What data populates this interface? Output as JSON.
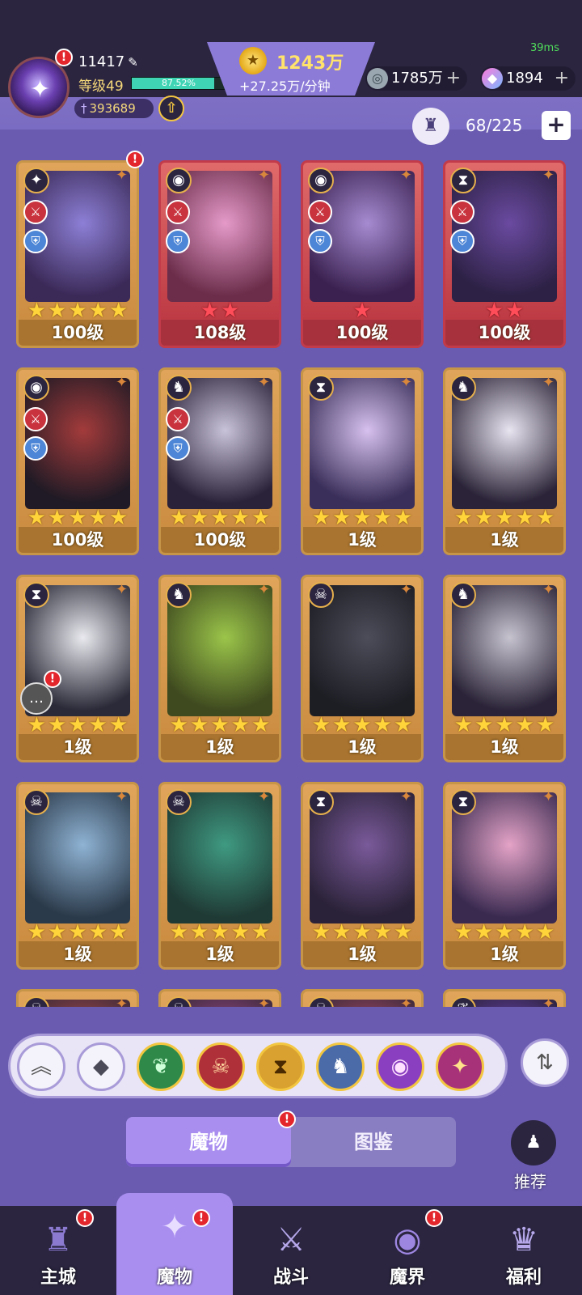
{
  "status": {
    "latency": "39ms"
  },
  "player": {
    "uid": "11417",
    "level_label": "等级49",
    "xp_percent": 87.52,
    "xp_text": "87.52%",
    "power": "393689"
  },
  "currency": {
    "gold": "1243万",
    "gold_rate": "+27.25万/分钟",
    "silver": "1785万",
    "gems": "1894"
  },
  "roster": {
    "capacity": "68/225"
  },
  "cards": [
    {
      "level": "100级",
      "stars": 5,
      "star_color": "gold",
      "faction": "✦",
      "style": "gold",
      "art": [
        "#3b2a58",
        "#8d7fd6"
      ],
      "buffs": true,
      "alert": true
    },
    {
      "level": "108级",
      "stars": 2,
      "star_color": "red",
      "faction": "◉",
      "style": "red",
      "art": [
        "#6b2d4a",
        "#e59ac9"
      ],
      "buffs": true,
      "alert": false
    },
    {
      "level": "100级",
      "stars": 1,
      "star_color": "red",
      "faction": "◉",
      "style": "red",
      "art": [
        "#3a2150",
        "#a68bd1"
      ],
      "buffs": true,
      "alert": false
    },
    {
      "level": "100级",
      "stars": 2,
      "star_color": "red",
      "faction": "⧗",
      "style": "red",
      "art": [
        "#2d2145",
        "#6a4aa0"
      ],
      "buffs": true,
      "alert": false
    },
    {
      "level": "100级",
      "stars": 5,
      "star_color": "gold",
      "faction": "◉",
      "style": "gold",
      "art": [
        "#1f1a25",
        "#a33b3b"
      ],
      "buffs": true,
      "alert": false
    },
    {
      "level": "100级",
      "stars": 5,
      "star_color": "gold",
      "faction": "♞",
      "style": "gold",
      "art": [
        "#2a2238",
        "#c9c3d9"
      ],
      "buffs": true,
      "alert": false
    },
    {
      "level": "1级",
      "stars": 5,
      "star_color": "gold",
      "faction": "⧗",
      "style": "gold",
      "art": [
        "#3a2f5a",
        "#d7c1ee"
      ],
      "buffs": false,
      "alert": false
    },
    {
      "level": "1级",
      "stars": 5,
      "star_color": "gold",
      "faction": "♞",
      "style": "gold",
      "art": [
        "#2b2438",
        "#e8e4f0"
      ],
      "buffs": false,
      "alert": false
    },
    {
      "level": "1级",
      "stars": 5,
      "star_color": "gold",
      "faction": "⧗",
      "style": "gold",
      "art": [
        "#2a2a38",
        "#e9e9ef"
      ],
      "buffs": false,
      "alert": false,
      "chat": true
    },
    {
      "level": "1级",
      "stars": 5,
      "star_color": "gold",
      "faction": "♞",
      "style": "gold",
      "art": [
        "#3f4a1f",
        "#9bc54a"
      ],
      "buffs": false,
      "alert": false
    },
    {
      "level": "1级",
      "stars": 5,
      "star_color": "gold",
      "faction": "☠",
      "style": "gold",
      "art": [
        "#1d1d24",
        "#4d4d5a"
      ],
      "buffs": false,
      "alert": false
    },
    {
      "level": "1级",
      "stars": 5,
      "star_color": "gold",
      "faction": "♞",
      "style": "gold",
      "art": [
        "#2b2438",
        "#c6c3cf"
      ],
      "buffs": false,
      "alert": false
    },
    {
      "level": "1级",
      "stars": 5,
      "star_color": "gold",
      "faction": "☠",
      "style": "gold",
      "art": [
        "#2b3a4a",
        "#8fb3d4"
      ],
      "buffs": false,
      "alert": false
    },
    {
      "level": "1级",
      "stars": 5,
      "star_color": "gold",
      "faction": "☠",
      "style": "gold",
      "art": [
        "#1f3a34",
        "#3f9a82"
      ],
      "buffs": false,
      "alert": false
    },
    {
      "level": "1级",
      "stars": 5,
      "star_color": "gold",
      "faction": "⧗",
      "style": "gold",
      "art": [
        "#2a2238",
        "#7a5a9a"
      ],
      "buffs": false,
      "alert": false
    },
    {
      "level": "1级",
      "stars": 5,
      "star_color": "gold",
      "faction": "⧗",
      "style": "gold",
      "art": [
        "#3a2a50",
        "#e4a3c7"
      ],
      "buffs": false,
      "alert": false
    },
    {
      "level": "",
      "stars": 0,
      "star_color": "gold",
      "faction": "☠",
      "style": "gold",
      "art": [
        "#3a2a38",
        "#c45050"
      ],
      "buffs": false,
      "alert": false
    },
    {
      "level": "",
      "stars": 0,
      "star_color": "gold",
      "faction": "☠",
      "style": "gold",
      "art": [
        "#3a2a38",
        "#b04fa0"
      ],
      "buffs": false,
      "alert": false
    },
    {
      "level": "",
      "stars": 0,
      "star_color": "gold",
      "faction": "☠",
      "style": "gold",
      "art": [
        "#3a2a38",
        "#c45078"
      ],
      "buffs": false,
      "alert": false
    },
    {
      "level": "",
      "stars": 0,
      "star_color": "gold",
      "faction": "❦",
      "style": "gold",
      "art": [
        "#2a2238",
        "#7a4ad0"
      ],
      "buffs": false,
      "alert": false
    }
  ],
  "filters": [
    {
      "name": "collapse-filter-button",
      "glyph": "︽",
      "bg": "#f4f2fa",
      "fg": "#555"
    },
    {
      "name": "filter-all-button",
      "glyph": "◆",
      "bg": "#f4f2fa",
      "fg": "#4a4a58"
    },
    {
      "name": "filter-nature-button",
      "glyph": "❦",
      "bg": "#2f8a4a",
      "fg": "#cfffd8"
    },
    {
      "name": "filter-demon-button",
      "glyph": "☠",
      "bg": "#b0303a",
      "fg": "#ffd9a0"
    },
    {
      "name": "filter-time-button",
      "glyph": "⧗",
      "bg": "#d9a12f",
      "fg": "#4a2a00"
    },
    {
      "name": "filter-beast-button",
      "glyph": "♞",
      "bg": "#4a6aa8",
      "fg": "#ffffff"
    },
    {
      "name": "filter-eye-button",
      "glyph": "◉",
      "bg": "#8a3fc0",
      "fg": "#ffe1ff"
    },
    {
      "name": "filter-star-button",
      "glyph": "✦",
      "bg": "#a8327a",
      "fg": "#ffe28a"
    }
  ],
  "tabs": {
    "monsters": "魔物",
    "codex": "图鉴"
  },
  "recommend": {
    "label": "推荐"
  },
  "nav": [
    {
      "label": "主城",
      "icon": "♜",
      "color": "#8b7ad0",
      "alert": true,
      "active": false
    },
    {
      "label": "魔物",
      "icon": "✦",
      "color": "#e8dcff",
      "alert": true,
      "active": true
    },
    {
      "label": "战斗",
      "icon": "⚔",
      "color": "#b6a8ea",
      "alert": false,
      "active": false
    },
    {
      "label": "魔界",
      "icon": "◉",
      "color": "#9d86e0",
      "alert": true,
      "active": false
    },
    {
      "label": "福利",
      "icon": "♛",
      "color": "#b6a8ea",
      "alert": false,
      "active": false
    }
  ]
}
